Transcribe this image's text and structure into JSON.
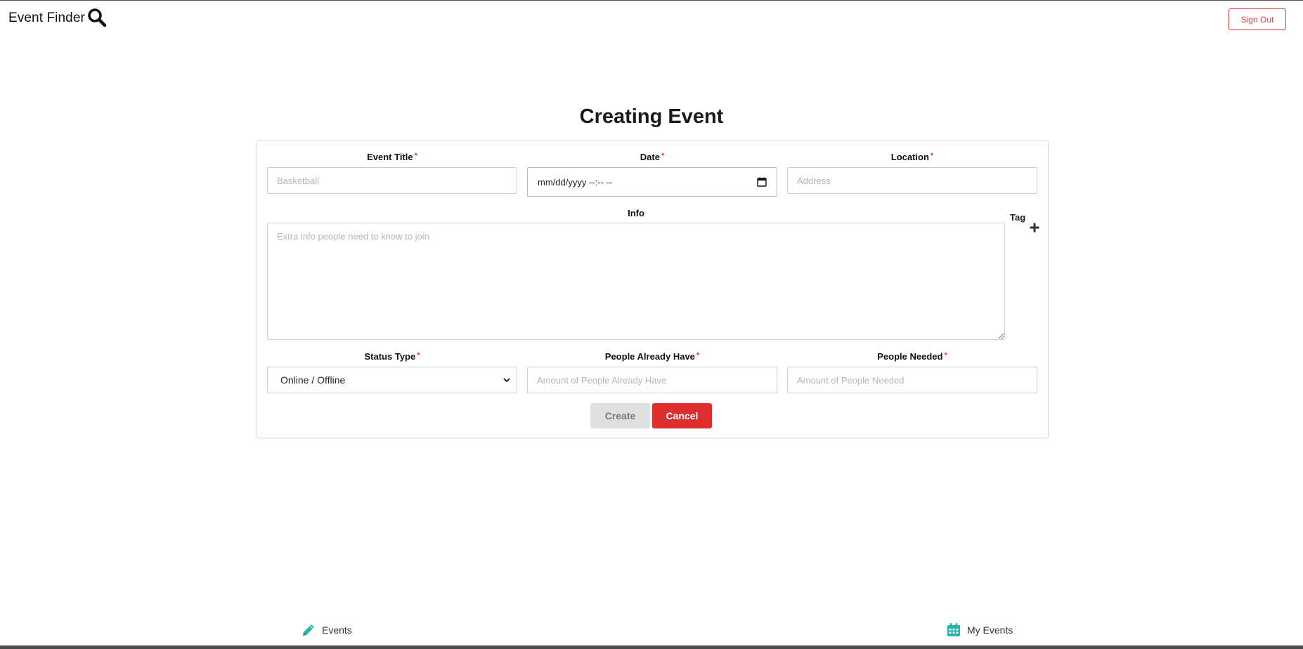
{
  "header": {
    "brand": "Event Finder",
    "sign_out_label": "Sign Out"
  },
  "page": {
    "title": "Creating Event"
  },
  "form": {
    "event_title": {
      "label": "Event Title",
      "required_mark": "*",
      "placeholder": "Basketball"
    },
    "date": {
      "label": "Date",
      "required_mark": "*",
      "value": "mm/dd/yyyy --:-- --"
    },
    "location": {
      "label": "Location",
      "required_mark": "*",
      "placeholder": "Address"
    },
    "info": {
      "label": "Info",
      "placeholder": "Extra info people need to know to join"
    },
    "tag": {
      "label": "Tag",
      "add_icon": "plus-icon"
    },
    "status_type": {
      "label": "Status Type",
      "required_mark": "*",
      "selected": "Online / Offline"
    },
    "people_have": {
      "label": "People Already Have",
      "required_mark": "*",
      "placeholder": "Amount of People Already Have"
    },
    "people_needed": {
      "label": "People Needed",
      "required_mark": "*",
      "placeholder": "Amount of People Needed"
    },
    "create_label": "Create",
    "cancel_label": "Cancel"
  },
  "bottom_nav": {
    "events": {
      "label": "Events",
      "icon": "pencil-icon"
    },
    "my_events": {
      "label": "My Events",
      "icon": "calendar-icon"
    }
  },
  "colors": {
    "accent_red": "#dc2e2e",
    "teal_icon": "#26b6a8",
    "required_red": "#e23b3b"
  }
}
